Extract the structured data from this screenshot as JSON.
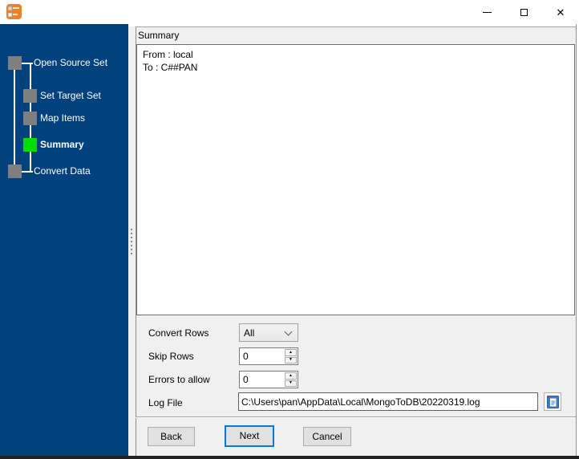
{
  "window": {
    "icons": {
      "minimize": "minimize-icon",
      "maximize": "maximize-icon",
      "close": "✕"
    }
  },
  "sidebar": {
    "steps": [
      {
        "label": "Open Source Set",
        "level": 1,
        "active": false,
        "box_color": "#7f7f7f"
      },
      {
        "label": "Set Target Set",
        "level": 2,
        "active": false,
        "box_color": "#7f7f7f"
      },
      {
        "label": "Map Items",
        "level": 2,
        "active": false,
        "box_color": "#7f7f7f"
      },
      {
        "label": "Summary",
        "level": 2,
        "active": true,
        "box_color": "#00dc00"
      },
      {
        "label": "Convert Data",
        "level": 1,
        "active": false,
        "box_color": "#7f7f7f"
      }
    ],
    "colors": {
      "background": "#00417e",
      "inactive_step": "#7f7f7f",
      "active_step": "#00dc00",
      "text": "#ffffff"
    }
  },
  "main": {
    "caption": "Summary",
    "summary_lines": [
      "From : local",
      "To : C##PAN"
    ]
  },
  "form": {
    "convert_rows": {
      "label": "Convert Rows",
      "value": "All"
    },
    "skip_rows": {
      "label": "Skip Rows",
      "value": "0"
    },
    "errors_to_allow": {
      "label": "Errors to allow",
      "value": "0"
    },
    "log_file": {
      "label": "Log File",
      "value": "C:\\Users\\pan\\AppData\\Local\\MongoToDB\\20220319.log"
    }
  },
  "icons": {
    "spinner_up": "▲",
    "spinner_down": "▼",
    "chevron": "chevron-down-icon",
    "browse": "document-icon"
  },
  "footer": {
    "back": "Back",
    "next": "Next",
    "cancel": "Cancel"
  },
  "colors": {
    "accent": "#0078d7",
    "titlebar": "#ffffff",
    "panel": "#f0f0f0",
    "app_icon": "#e8832c"
  }
}
